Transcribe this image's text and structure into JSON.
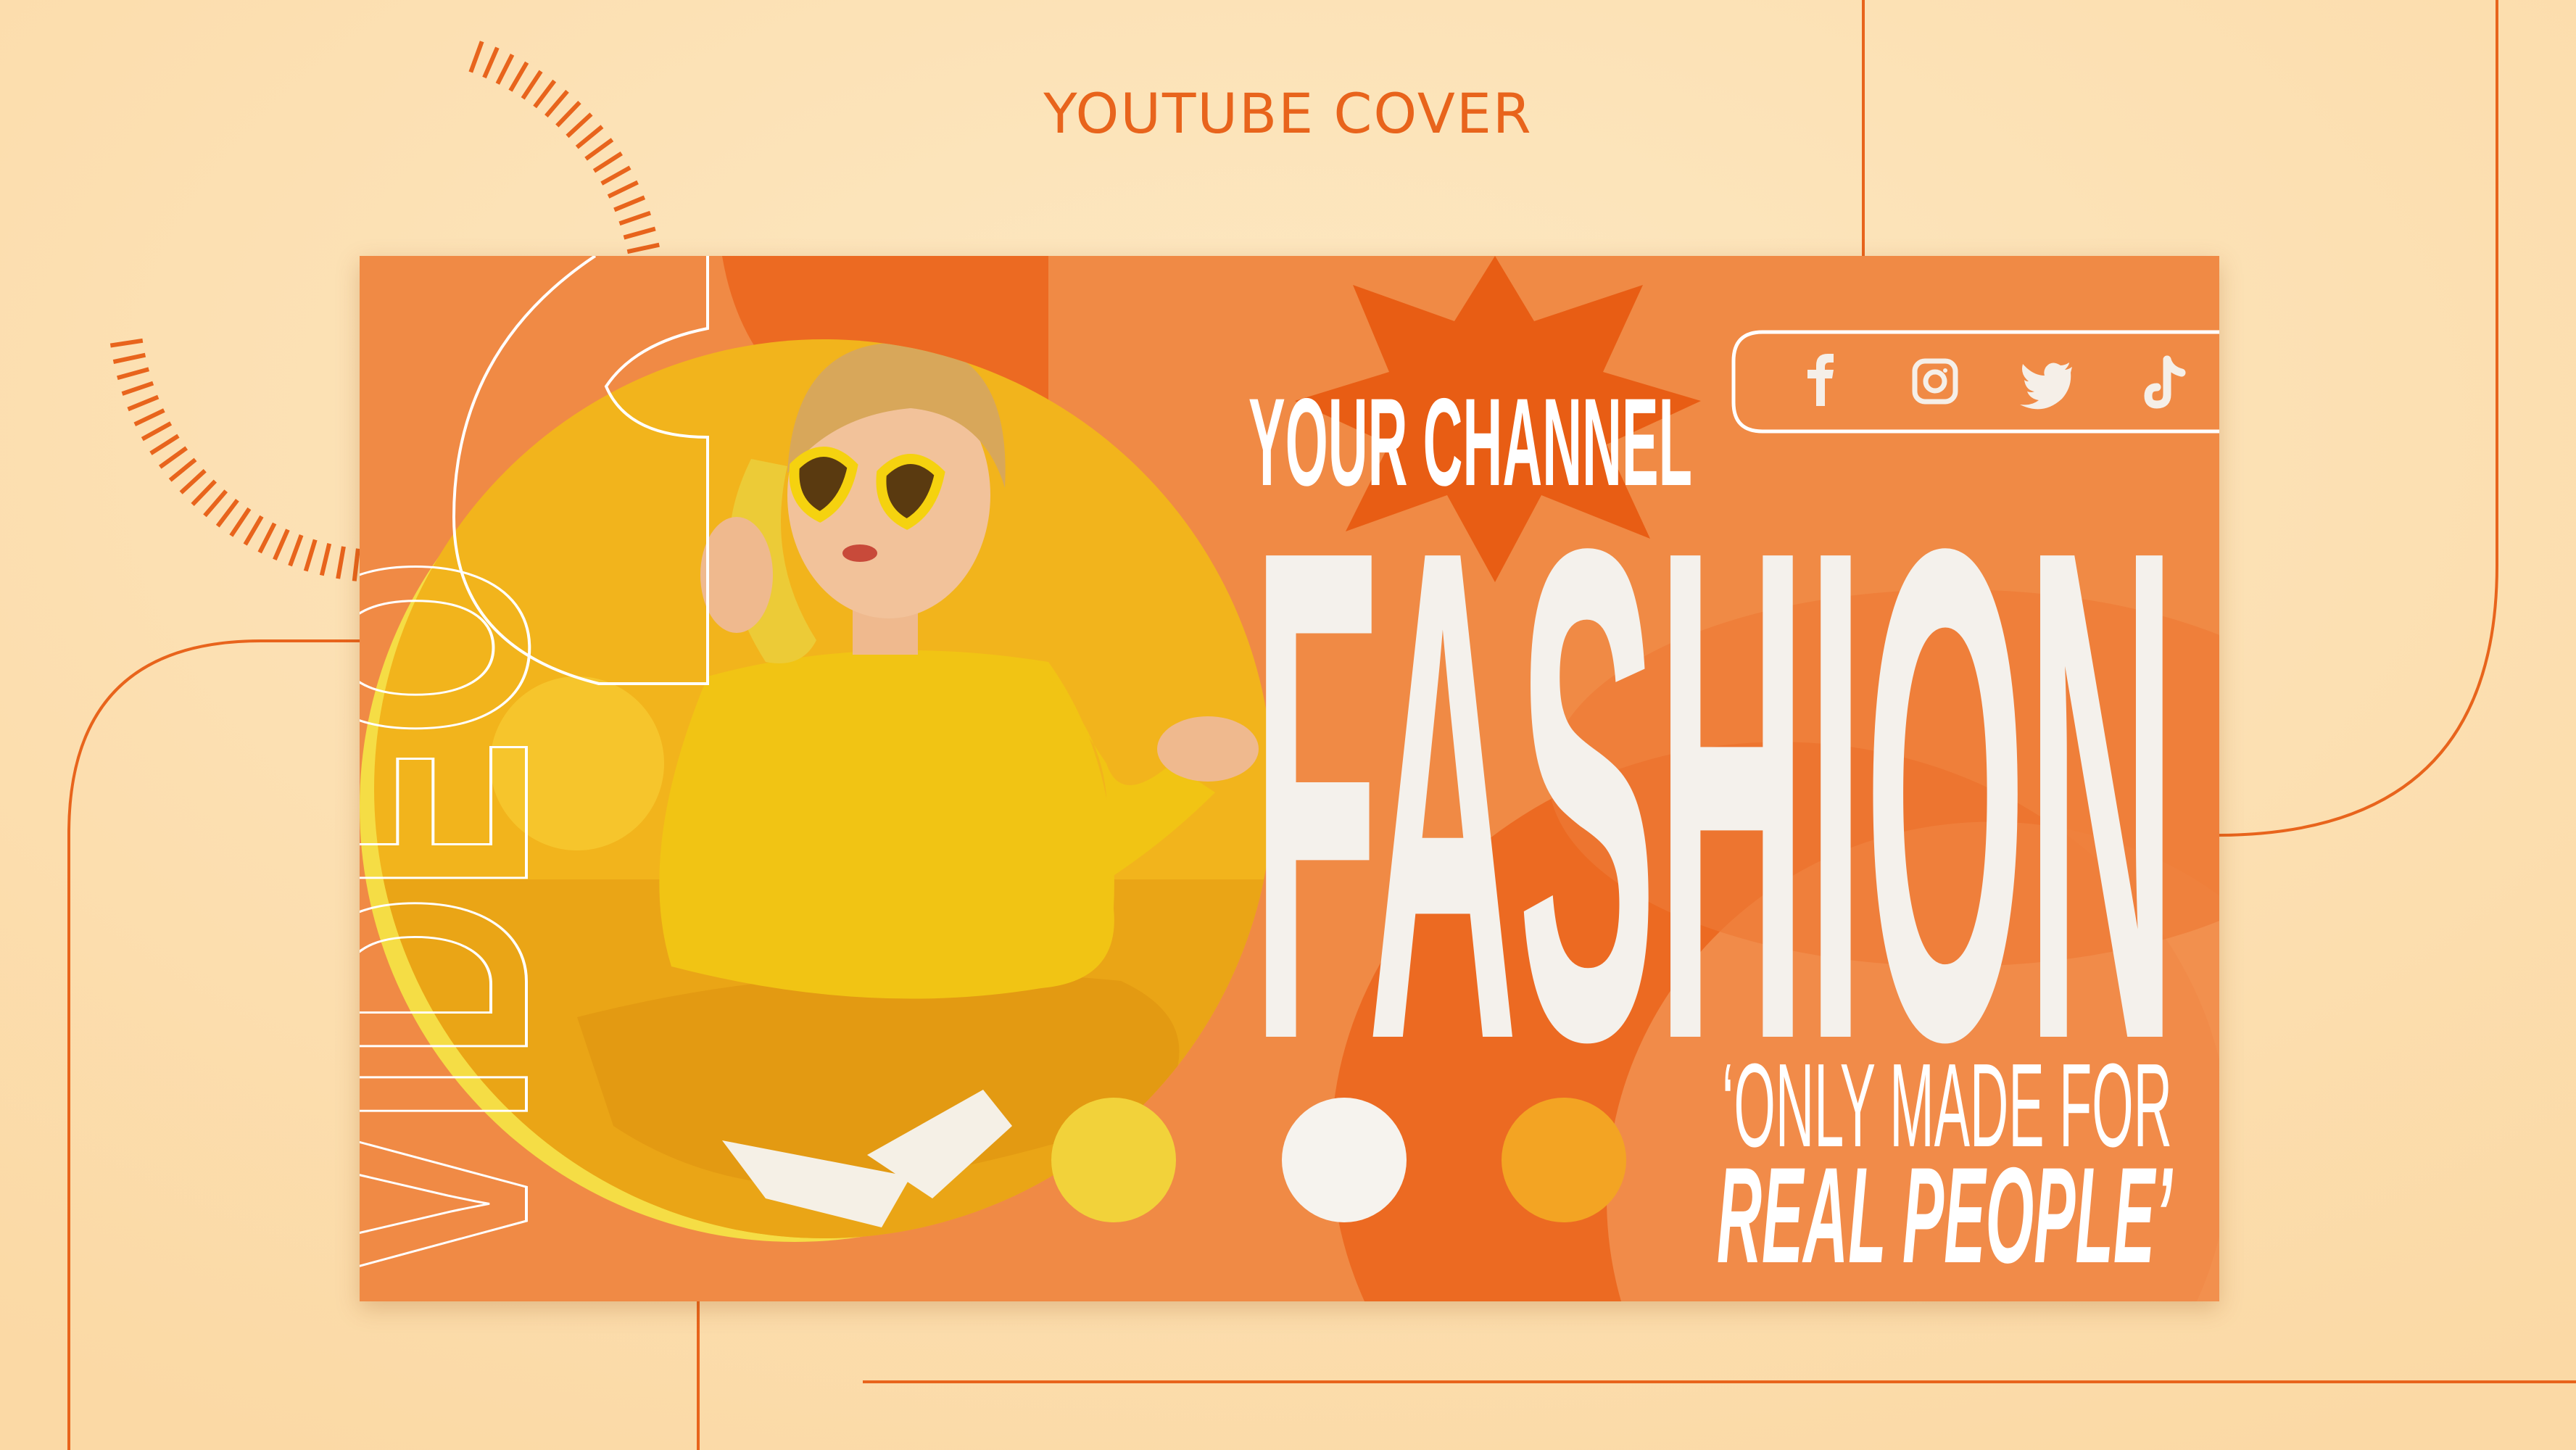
{
  "page": {
    "title": "YOUTUBE COVER"
  },
  "cover": {
    "channel_label": "YOUR CHANNEL",
    "headline": "FASHION",
    "side_word": "VIDEO",
    "tagline_line1": "‘ONLY MADE FOR",
    "tagline_line2": "REAL PEOPLE’",
    "social_icons": [
      "facebook-icon",
      "instagram-icon",
      "twitter-icon",
      "tiktok-icon"
    ]
  },
  "colors": {
    "background": "#fde3b8",
    "accent": "#e8641c",
    "card": "#f08a45",
    "card_dark": "#e85d14",
    "yellow": "#f3c623",
    "text": "#ffffff"
  }
}
